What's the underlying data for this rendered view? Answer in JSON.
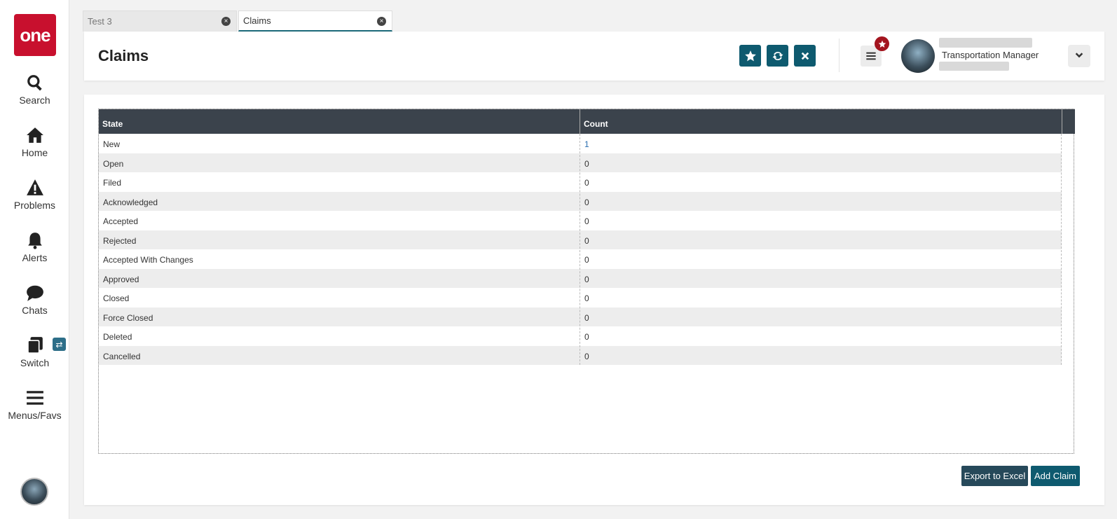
{
  "app": {
    "logo_text": "one",
    "brand_color": "#c8102e",
    "accent_color": "#0e5a6f"
  },
  "sidebar": {
    "items": [
      {
        "label": "Search",
        "icon": "search-icon"
      },
      {
        "label": "Home",
        "icon": "home-icon"
      },
      {
        "label": "Problems",
        "icon": "warning-icon"
      },
      {
        "label": "Alerts",
        "icon": "bell-icon"
      },
      {
        "label": "Chats",
        "icon": "chat-icon"
      },
      {
        "label": "Switch",
        "icon": "switch-icon"
      },
      {
        "label": "Menus/Favs",
        "icon": "hamburger-icon"
      }
    ],
    "switch_badge": "⇄"
  },
  "tabs": [
    {
      "label": "Test 3",
      "active": false
    },
    {
      "label": "Claims",
      "active": true
    }
  ],
  "header": {
    "title": "Claims",
    "user_role": "Transportation Manager",
    "buttons": [
      "star-icon",
      "refresh-icon",
      "close-icon"
    ]
  },
  "table": {
    "columns": [
      "State",
      "Count"
    ],
    "rows": [
      {
        "state": "New",
        "count": "1"
      },
      {
        "state": "Open",
        "count": "0"
      },
      {
        "state": "Filed",
        "count": "0"
      },
      {
        "state": "Acknowledged",
        "count": "0"
      },
      {
        "state": "Accepted",
        "count": "0"
      },
      {
        "state": "Rejected",
        "count": "0"
      },
      {
        "state": "Accepted With Changes",
        "count": "0"
      },
      {
        "state": "Approved",
        "count": "0"
      },
      {
        "state": "Closed",
        "count": "0"
      },
      {
        "state": "Force Closed",
        "count": "0"
      },
      {
        "state": "Deleted",
        "count": "0"
      },
      {
        "state": "Cancelled",
        "count": "0"
      }
    ]
  },
  "footer": {
    "export_label": "Export to Excel",
    "add_label": "Add Claim"
  }
}
